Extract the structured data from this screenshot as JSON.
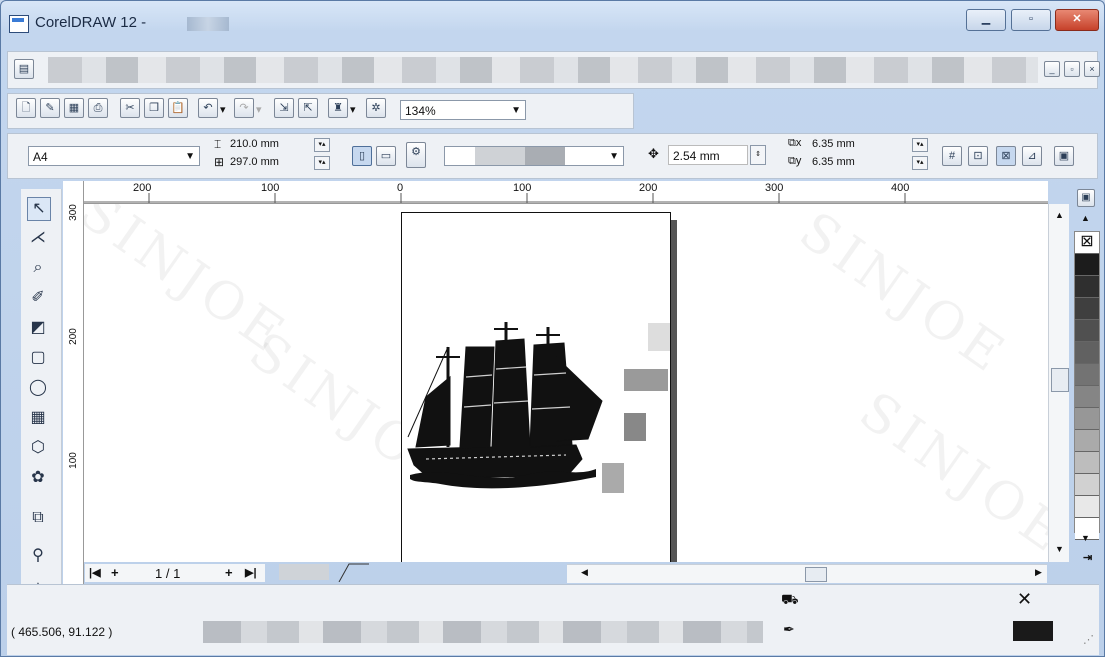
{
  "window": {
    "title": "CorelDRAW 12 -"
  },
  "standard_toolbar": {
    "zoom_value": "134%"
  },
  "property_bar": {
    "paper_size": "A4",
    "width": "210.0 mm",
    "height": "297.0 mm",
    "nudge": "2.54 mm",
    "dup_x": "6.35 mm",
    "dup_y": "6.35 mm"
  },
  "ruler": {
    "h_ticks": [
      "200",
      "100",
      "0",
      "100",
      "200",
      "300",
      "400"
    ],
    "v_ticks": [
      "300",
      "200",
      "100"
    ]
  },
  "page_nav": {
    "first": "|◀",
    "add_before": "+",
    "page_label": "1 / 1",
    "add_after": "+",
    "last": "▶|"
  },
  "status": {
    "coords": "( 465.506, 91.122 )"
  },
  "palette": {
    "colors": [
      "#1c1c1c",
      "#2f2f2f",
      "#3f3f3f",
      "#505050",
      "#616161",
      "#737373",
      "#858585",
      "#979797",
      "#aaaaaa",
      "#bdbdbd",
      "#d1d1d1",
      "#e8e8e8",
      "#ffffff"
    ]
  },
  "watermark_text": "SINJOE"
}
